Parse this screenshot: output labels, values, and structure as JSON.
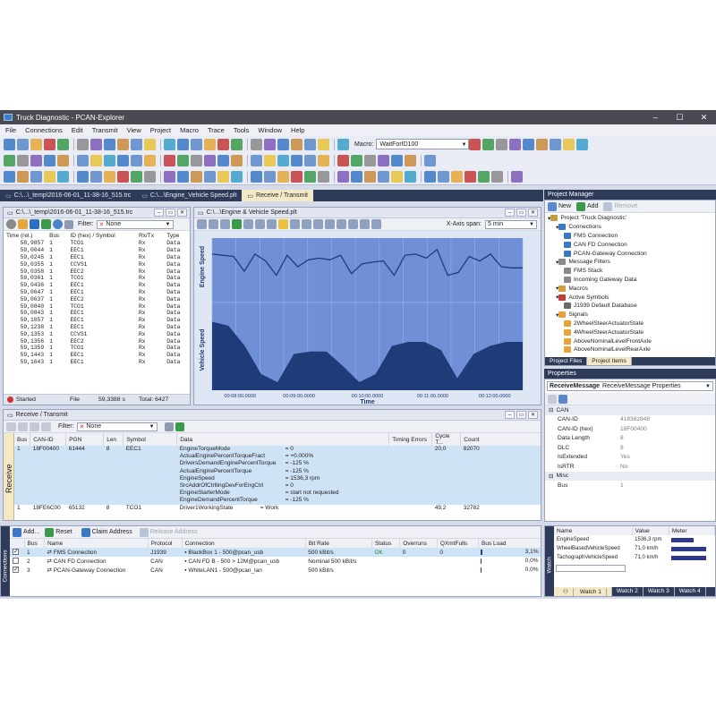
{
  "title": "Truck Diagnostic - PCAN-Explorer",
  "menu": [
    "File",
    "Connections",
    "Edit",
    "Transmit",
    "View",
    "Project",
    "Macro",
    "Trace",
    "Tools",
    "Window",
    "Help"
  ],
  "macro": {
    "label": "Macro:",
    "value": "WaitForID100"
  },
  "doctabs": [
    "C:\\...\\_temp\\2016-06-01_11-38-16_515.trc",
    "C:\\...\\Engine_Vehicle Speed.plt",
    "Receive / Transmit"
  ],
  "trace": {
    "title": "C:\\...\\_temp\\2016-06-01_11-38-16_515.trc",
    "filter_label": "Filter:",
    "filter_value": "None",
    "headers": [
      "Time (rel.)",
      "Bus",
      "ID (hex) / Symbol",
      "Rx/Tx",
      "Type"
    ],
    "rows": [
      [
        "58,9857",
        "1",
        "TCO1",
        "Rx",
        "Data"
      ],
      [
        "59,0044",
        "1",
        "EEC1",
        "Rx",
        "Data"
      ],
      [
        "59,0245",
        "1",
        "EEC1",
        "Rx",
        "Data"
      ],
      [
        "59,0355",
        "1",
        "CCVS1",
        "Rx",
        "Data"
      ],
      [
        "59,0358",
        "1",
        "EEC2",
        "Rx",
        "Data"
      ],
      [
        "59,0361",
        "1",
        "TCO1",
        "Rx",
        "Data"
      ],
      [
        "59,0436",
        "1",
        "EEC1",
        "Rx",
        "Data"
      ],
      [
        "59,0647",
        "1",
        "EEC1",
        "Rx",
        "Data"
      ],
      [
        "59,0637",
        "1",
        "EEC2",
        "Rx",
        "Data"
      ],
      [
        "59,0840",
        "1",
        "TCO1",
        "Rx",
        "Data"
      ],
      [
        "59,0843",
        "1",
        "EEC1",
        "Rx",
        "Data"
      ],
      [
        "59,1057",
        "1",
        "EEC1",
        "Rx",
        "Data"
      ],
      [
        "59,1238",
        "1",
        "EEC1",
        "Rx",
        "Data"
      ],
      [
        "59,1353",
        "1",
        "CCVS1",
        "Rx",
        "Data"
      ],
      [
        "59,1356",
        "1",
        "EEC2",
        "Rx",
        "Data"
      ],
      [
        "59,1359",
        "1",
        "TCO1",
        "Rx",
        "Data"
      ],
      [
        "59,1443",
        "1",
        "EEC1",
        "Rx",
        "Data"
      ],
      [
        "59,1643",
        "1",
        "EEC1",
        "Rx",
        "Data"
      ]
    ],
    "status": {
      "state": "Started",
      "file_label": "File",
      "file_value": "59,3388 s",
      "total": "Total: 6427"
    }
  },
  "plot": {
    "title": "C:\\...\\Engine & Vehicle Speed.plt",
    "xaxis_span_label": "X-Axis span:",
    "xaxis_span_value": "5 min"
  },
  "chart_data": [
    {
      "type": "line",
      "ylabel": "Engine Speed",
      "xlabel": "Time",
      "x": [
        "00:08:00.0000",
        "00:09:00.0000",
        "00:10:00.0000",
        "00:11:00.0000",
        "00:12:00.0000"
      ],
      "series": [
        {
          "values": [
            0.72,
            0.7,
            0.68,
            0.42,
            0.72,
            0.6,
            0.35,
            0.7,
            0.5,
            0.62,
            0.65,
            0.62,
            0.7,
            0.38,
            0.55,
            0.58,
            0.6,
            0.35,
            0.7,
            0.72,
            0.65,
            0.8,
            0.35,
            0.4,
            0.68,
            0.6,
            0.72,
            0.5,
            0.48,
            0.48
          ]
        }
      ]
    },
    {
      "type": "area",
      "ylabel": "Vehicle Speed",
      "xlabel": "Time",
      "x": [
        "00:08:00.0000",
        "00:09:00.0000",
        "00:10:00.0000",
        "00:11:00.0000",
        "00:12:00.0000"
      ],
      "series": [
        {
          "values": [
            0.85,
            0.8,
            0.55,
            0.2,
            0.1,
            0.45,
            0.48,
            0.48,
            0.3,
            0.1,
            0.2,
            0.55,
            0.6,
            0.6,
            0.5,
            0.15,
            0.45,
            0.55,
            0.6,
            0.6
          ]
        }
      ]
    }
  ],
  "rx": {
    "title": "Receive / Transmit",
    "filter_label": "Filter:",
    "filter_value": "None",
    "side_label": "Receive",
    "headers": [
      "Bus",
      "CAN-ID",
      "PGN",
      "Len",
      "Symbol",
      "Data",
      "Timing Errors",
      "Cycle T...",
      "Count"
    ],
    "row1": {
      "bus": "1",
      "canid": "18F00400",
      "pgn": "61444",
      "len": "8",
      "symbol": "EEC1",
      "cycle": "20,0",
      "count": "82070"
    },
    "signals": [
      [
        "EngineTorqueMode",
        "= 0"
      ],
      [
        "ActualEnginePercentTorqueFract",
        "= +0.000%"
      ],
      [
        "DriversDemandEnginePercentTorque",
        "= -125 %"
      ],
      [
        "ActualEnginePercentTorque",
        "= -125 %"
      ],
      [
        "EngineSpeed",
        "= 1536,3 rpm"
      ],
      [
        "SrcAddrOfCtrllingDevForEngCtrl",
        "= 0"
      ],
      [
        "EngineStarterMode",
        "= start not requested"
      ],
      [
        "EngineDemandPercentTorque",
        "= -125 %"
      ]
    ],
    "row2": {
      "bus": "1",
      "canid": "18FE6C00",
      "pgn": "65132",
      "len": "8",
      "symbol": "TCO1",
      "data": "Driver1WorkingState",
      "dataval": "= Work",
      "cycle": "49,2",
      "count": "32782"
    }
  },
  "connections": {
    "side_label": "Connections",
    "toolbar": {
      "add": "Add...",
      "reset": "Reset",
      "claim": "Claim Address",
      "release": "Release Address"
    },
    "headers": [
      "Bus",
      "Name",
      "Protocol",
      "Connection",
      "Bit Rate",
      "Status",
      "Overruns",
      "QXmtFulls",
      "Bus Load"
    ],
    "rows": [
      {
        "checked": true,
        "bus": "1",
        "name": "FMS Connection",
        "protocol": "J1939",
        "conn": "BlackBox 1 - 500@pcan_usb",
        "bitrate": "500 kBit/s",
        "status": "OK",
        "overruns": "0",
        "qxmt": "0",
        "load": "3,1%",
        "loadpct": 3.1
      },
      {
        "checked": false,
        "bus": "2",
        "name": "CAN FD Connection",
        "protocol": "CAN",
        "conn": "CAN FD B - 500 > 12M@pcan_usb",
        "bitrate": "Nominal 500 kBit/s",
        "status": "",
        "overruns": "",
        "qxmt": "",
        "load": "0,0%",
        "loadpct": 0
      },
      {
        "checked": true,
        "bus": "3",
        "name": "PCAN-Gateway Connection",
        "protocol": "CAN",
        "conn": "WhiteLAN1 - 500@pcan_lan",
        "bitrate": "500 kBit/s",
        "status": "",
        "overruns": "",
        "qxmt": "",
        "load": "0,0%",
        "loadpct": 0
      }
    ]
  },
  "project_manager": {
    "title": "Project Manager",
    "toolbar": {
      "new": "New",
      "add": "Add",
      "remove": "Remove"
    },
    "tree": [
      {
        "lvl": 0,
        "text": "Project 'Truck Diagnostic'",
        "color": "#c99a3a"
      },
      {
        "lvl": 1,
        "text": "Connections",
        "color": "#3a78c4"
      },
      {
        "lvl": 2,
        "text": "FMS Connection",
        "color": "#3a78c4"
      },
      {
        "lvl": 2,
        "text": "CAN FD Connection",
        "color": "#3a78c4"
      },
      {
        "lvl": 2,
        "text": "PCAN-Gateway Connection",
        "color": "#3a78c4"
      },
      {
        "lvl": 1,
        "text": "Message Filters",
        "color": "#8a8a8a"
      },
      {
        "lvl": 2,
        "text": "FMS Stack",
        "color": "#8a8a8a"
      },
      {
        "lvl": 2,
        "text": "Incoming Gateway Data",
        "color": "#8a8a8a"
      },
      {
        "lvl": 1,
        "text": "Macros",
        "color": "#d0a13a"
      },
      {
        "lvl": 1,
        "text": "Active Symbols",
        "color": "#c23e3e"
      },
      {
        "lvl": 2,
        "text": "J1939 Default Database",
        "color": "#6b6b6b"
      },
      {
        "lvl": 1,
        "text": "Signals",
        "color": "#e8a23a"
      },
      {
        "lvl": 2,
        "text": "2WheelSteerActuatorState",
        "color": "#e8a23a"
      },
      {
        "lvl": 2,
        "text": "4WheelSteerActuatorState",
        "color": "#e8a23a"
      },
      {
        "lvl": 2,
        "text": "AboveNominalLevelFrontAxle",
        "color": "#e8a23a"
      },
      {
        "lvl": 2,
        "text": "AboveNominalLevelRearAxle",
        "color": "#e8a23a"
      }
    ],
    "tabs": [
      "Project Files",
      "Project Items"
    ]
  },
  "properties": {
    "title": "Properties",
    "object_bold": "ReceiveMessage",
    "object_rest": "ReceiveMessage Properties",
    "cat1": "CAN",
    "rows": [
      [
        "CAN-ID",
        "418382848"
      ],
      [
        "CAN-ID (hex)",
        "18F00400"
      ],
      [
        "Data Length",
        "8"
      ],
      [
        "DLC",
        "8"
      ],
      [
        "IsExtended",
        "Yes"
      ],
      [
        "IsRTR",
        "No"
      ]
    ],
    "cat2": "Misc",
    "rows2": [
      [
        "Bus",
        "1"
      ]
    ]
  },
  "watch": {
    "side_label": "Watch",
    "headers": [
      "Name",
      "Value",
      "Meter"
    ],
    "rows": [
      {
        "name": "EngineSpeed",
        "value": "1536,3 rpm",
        "meter": 0.35
      },
      {
        "name": "WheelBasedVehicleSpeed",
        "value": "71,0 km/h",
        "meter": 0.55
      },
      {
        "name": "TachographVehicleSpeed",
        "value": "71,0 km/h",
        "meter": 0.55
      }
    ],
    "tabs": [
      "Watch 1",
      "Watch 2",
      "Watch 3",
      "Watch 4"
    ]
  },
  "colors": {
    "accent": "#2d3a58",
    "plotbg": "#6f8fd6",
    "plotfill": "#1f3b78"
  }
}
